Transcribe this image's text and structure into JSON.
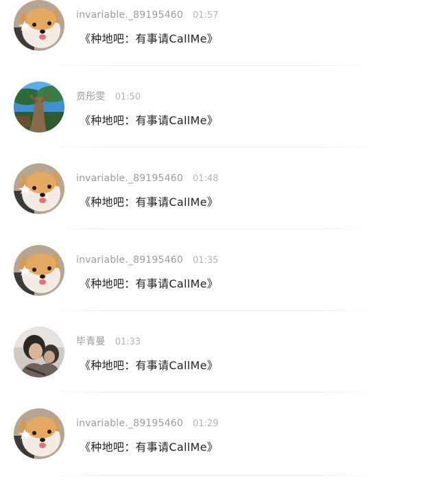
{
  "comments": [
    {
      "username": "invariable._89195460",
      "time": "01:57",
      "message": "《种地吧：有事请CallMe》",
      "avatar": "dog-avatar"
    },
    {
      "username": "贲彤雯",
      "time": "01:50",
      "message": "《种地吧：有事请CallMe》",
      "avatar": "tree-avatar"
    },
    {
      "username": "invariable._89195460",
      "time": "01:48",
      "message": "《种地吧：有事请CallMe》",
      "avatar": "dog-avatar"
    },
    {
      "username": "invariable._89195460",
      "time": "01:35",
      "message": "《种地吧：有事请CallMe》",
      "avatar": "dog-avatar"
    },
    {
      "username": "毕青曼",
      "time": "01:33",
      "message": "《种地吧：有事请CallMe》",
      "avatar": "person-avatar"
    },
    {
      "username": "invariable._89195460",
      "time": "01:29",
      "message": "《种地吧：有事请CallMe》",
      "avatar": "dog-avatar"
    }
  ]
}
